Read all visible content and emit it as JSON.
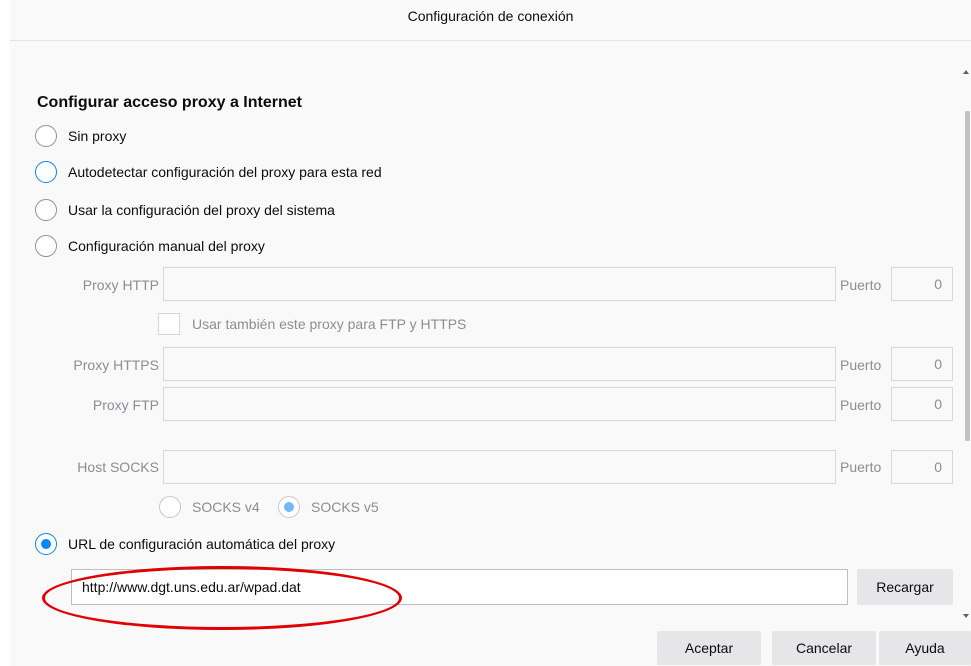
{
  "dialog": {
    "title": "Configuración de conexión"
  },
  "section": {
    "heading": "Configurar acceso proxy a Internet"
  },
  "proxy_options": [
    {
      "label": "Sin proxy"
    },
    {
      "label": "Autodetectar configuración del proxy para esta red"
    },
    {
      "label": "Usar la configuración del proxy del sistema"
    },
    {
      "label": "Configuración manual del proxy"
    }
  ],
  "manual": {
    "http_label": "Proxy HTTP",
    "http_value": "",
    "http_port_label": "Puerto",
    "http_port_value": "0",
    "share_label": "Usar también este proxy para FTP y HTTPS",
    "https_label": "Proxy HTTPS",
    "https_value": "",
    "https_port_label": "Puerto",
    "https_port_value": "0",
    "ftp_label": "Proxy FTP",
    "ftp_value": "",
    "ftp_port_label": "Puerto",
    "ftp_port_value": "0",
    "socks_label": "Host SOCKS",
    "socks_value": "",
    "socks_port_label": "Puerto",
    "socks_port_value": "0",
    "socks_v4_label": "SOCKS v4",
    "socks_v5_label": "SOCKS v5"
  },
  "autoconfig": {
    "label": "URL de configuración automática del proxy",
    "url_value": "http://www.dgt.uns.edu.ar/wpad.dat",
    "reload_label": "Recargar"
  },
  "footer": {
    "accept_label": "Aceptar",
    "cancel_label": "Cancelar",
    "help_label": "Ayuda"
  },
  "colors": {
    "accent": "#0a84ff",
    "annotation": "#e00000",
    "dialog_background": "#f9f9fa"
  }
}
